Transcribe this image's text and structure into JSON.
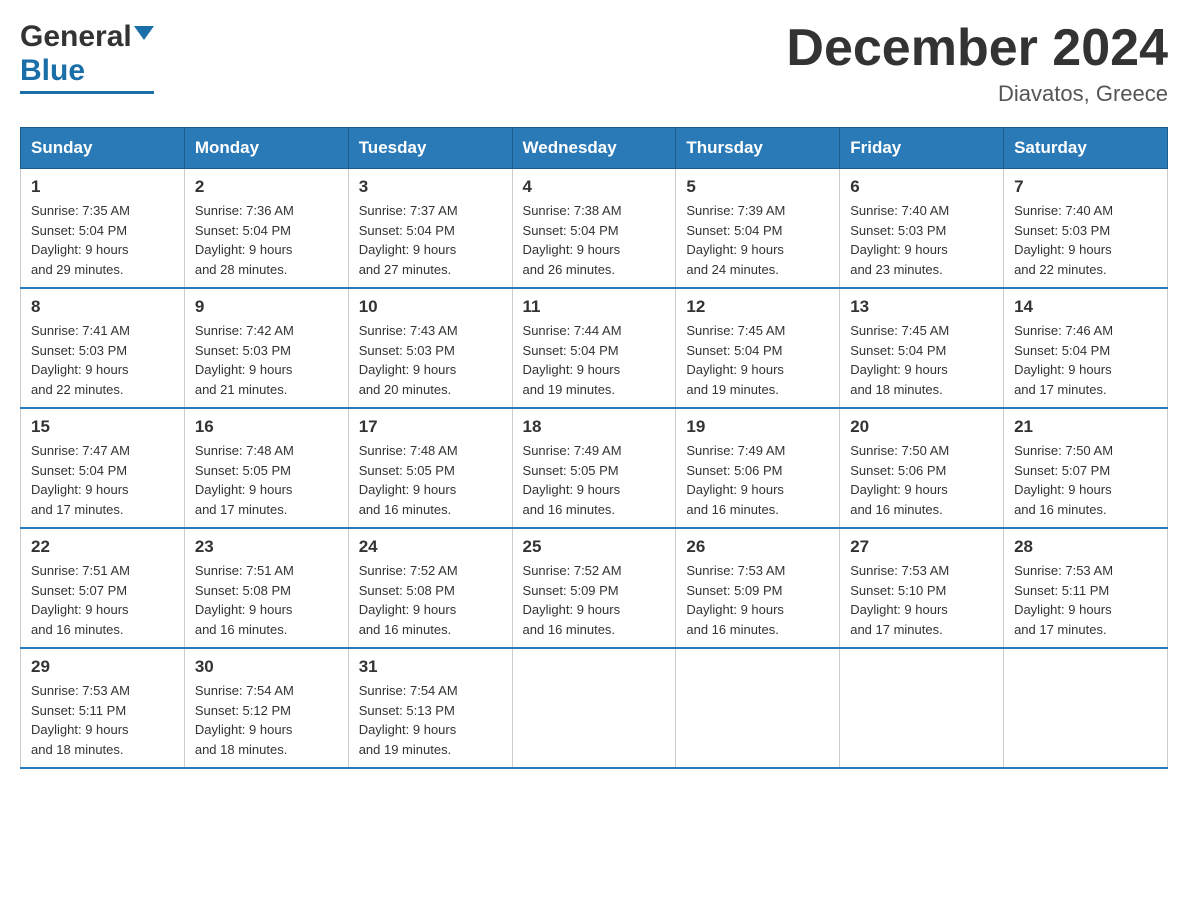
{
  "header": {
    "logo_general": "General",
    "logo_blue": "Blue",
    "month_title": "December 2024",
    "location": "Diavatos, Greece"
  },
  "days_of_week": [
    "Sunday",
    "Monday",
    "Tuesday",
    "Wednesday",
    "Thursday",
    "Friday",
    "Saturday"
  ],
  "weeks": [
    [
      {
        "day": "1",
        "sunrise": "7:35 AM",
        "sunset": "5:04 PM",
        "daylight": "9 hours and 29 minutes."
      },
      {
        "day": "2",
        "sunrise": "7:36 AM",
        "sunset": "5:04 PM",
        "daylight": "9 hours and 28 minutes."
      },
      {
        "day": "3",
        "sunrise": "7:37 AM",
        "sunset": "5:04 PM",
        "daylight": "9 hours and 27 minutes."
      },
      {
        "day": "4",
        "sunrise": "7:38 AM",
        "sunset": "5:04 PM",
        "daylight": "9 hours and 26 minutes."
      },
      {
        "day": "5",
        "sunrise": "7:39 AM",
        "sunset": "5:04 PM",
        "daylight": "9 hours and 24 minutes."
      },
      {
        "day": "6",
        "sunrise": "7:40 AM",
        "sunset": "5:03 PM",
        "daylight": "9 hours and 23 minutes."
      },
      {
        "day": "7",
        "sunrise": "7:40 AM",
        "sunset": "5:03 PM",
        "daylight": "9 hours and 22 minutes."
      }
    ],
    [
      {
        "day": "8",
        "sunrise": "7:41 AM",
        "sunset": "5:03 PM",
        "daylight": "9 hours and 22 minutes."
      },
      {
        "day": "9",
        "sunrise": "7:42 AM",
        "sunset": "5:03 PM",
        "daylight": "9 hours and 21 minutes."
      },
      {
        "day": "10",
        "sunrise": "7:43 AM",
        "sunset": "5:03 PM",
        "daylight": "9 hours and 20 minutes."
      },
      {
        "day": "11",
        "sunrise": "7:44 AM",
        "sunset": "5:04 PM",
        "daylight": "9 hours and 19 minutes."
      },
      {
        "day": "12",
        "sunrise": "7:45 AM",
        "sunset": "5:04 PM",
        "daylight": "9 hours and 19 minutes."
      },
      {
        "day": "13",
        "sunrise": "7:45 AM",
        "sunset": "5:04 PM",
        "daylight": "9 hours and 18 minutes."
      },
      {
        "day": "14",
        "sunrise": "7:46 AM",
        "sunset": "5:04 PM",
        "daylight": "9 hours and 17 minutes."
      }
    ],
    [
      {
        "day": "15",
        "sunrise": "7:47 AM",
        "sunset": "5:04 PM",
        "daylight": "9 hours and 17 minutes."
      },
      {
        "day": "16",
        "sunrise": "7:48 AM",
        "sunset": "5:05 PM",
        "daylight": "9 hours and 17 minutes."
      },
      {
        "day": "17",
        "sunrise": "7:48 AM",
        "sunset": "5:05 PM",
        "daylight": "9 hours and 16 minutes."
      },
      {
        "day": "18",
        "sunrise": "7:49 AM",
        "sunset": "5:05 PM",
        "daylight": "9 hours and 16 minutes."
      },
      {
        "day": "19",
        "sunrise": "7:49 AM",
        "sunset": "5:06 PM",
        "daylight": "9 hours and 16 minutes."
      },
      {
        "day": "20",
        "sunrise": "7:50 AM",
        "sunset": "5:06 PM",
        "daylight": "9 hours and 16 minutes."
      },
      {
        "day": "21",
        "sunrise": "7:50 AM",
        "sunset": "5:07 PM",
        "daylight": "9 hours and 16 minutes."
      }
    ],
    [
      {
        "day": "22",
        "sunrise": "7:51 AM",
        "sunset": "5:07 PM",
        "daylight": "9 hours and 16 minutes."
      },
      {
        "day": "23",
        "sunrise": "7:51 AM",
        "sunset": "5:08 PM",
        "daylight": "9 hours and 16 minutes."
      },
      {
        "day": "24",
        "sunrise": "7:52 AM",
        "sunset": "5:08 PM",
        "daylight": "9 hours and 16 minutes."
      },
      {
        "day": "25",
        "sunrise": "7:52 AM",
        "sunset": "5:09 PM",
        "daylight": "9 hours and 16 minutes."
      },
      {
        "day": "26",
        "sunrise": "7:53 AM",
        "sunset": "5:09 PM",
        "daylight": "9 hours and 16 minutes."
      },
      {
        "day": "27",
        "sunrise": "7:53 AM",
        "sunset": "5:10 PM",
        "daylight": "9 hours and 17 minutes."
      },
      {
        "day": "28",
        "sunrise": "7:53 AM",
        "sunset": "5:11 PM",
        "daylight": "9 hours and 17 minutes."
      }
    ],
    [
      {
        "day": "29",
        "sunrise": "7:53 AM",
        "sunset": "5:11 PM",
        "daylight": "9 hours and 18 minutes."
      },
      {
        "day": "30",
        "sunrise": "7:54 AM",
        "sunset": "5:12 PM",
        "daylight": "9 hours and 18 minutes."
      },
      {
        "day": "31",
        "sunrise": "7:54 AM",
        "sunset": "5:13 PM",
        "daylight": "9 hours and 19 minutes."
      },
      null,
      null,
      null,
      null
    ]
  ],
  "labels": {
    "sunrise": "Sunrise:",
    "sunset": "Sunset:",
    "daylight": "Daylight:"
  }
}
